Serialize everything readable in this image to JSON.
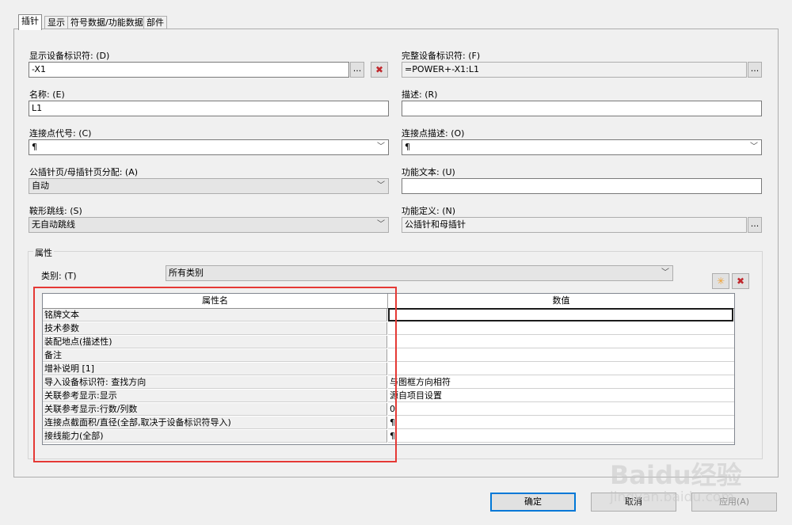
{
  "tabs": [
    "插针",
    "显示",
    "符号数据/功能数据",
    "部件"
  ],
  "fields": {
    "device_tag_label": "显示设备标识符: (D)",
    "device_tag_value": "-X1",
    "full_tag_label": "完整设备标识符: (F)",
    "full_tag_value": "=POWER+-X1:L1",
    "name_label": "名称: (E)",
    "name_value": "L1",
    "desc_label": "描述: (R)",
    "desc_value": "",
    "conn_code_label": "连接点代号: (C)",
    "conn_code_value": "¶",
    "conn_desc_label": "连接点描述: (O)",
    "conn_desc_value": "¶",
    "page_assign_label": "公插针页/母插针页分配: (A)",
    "page_assign_value": "自动",
    "func_text_label": "功能文本: (U)",
    "func_text_value": "",
    "jumper_label": "鞍形跳线: (S)",
    "jumper_value": "无自动跳线",
    "func_def_label": "功能定义: (N)",
    "func_def_value": "公插针和母插针",
    "browse_label": "...",
    "delete_glyph": "✖"
  },
  "properties": {
    "group_title": "属性",
    "category_label": "类别: (T)",
    "category_value": "所有类别",
    "new_glyph": "✳",
    "delete_glyph": "✖",
    "col_name": "属性名",
    "col_value": "数值",
    "rows": [
      {
        "name": "铭牌文本",
        "value": ""
      },
      {
        "name": "技术参数",
        "value": ""
      },
      {
        "name": "装配地点(描述性)",
        "value": ""
      },
      {
        "name": "备注",
        "value": ""
      },
      {
        "name": "增补说明 [1]",
        "value": ""
      },
      {
        "name": "导入设备标识符: 查找方向",
        "value": "与图框方向相符"
      },
      {
        "name": "关联参考显示:显示",
        "value": "源自项目设置"
      },
      {
        "name": "关联参考显示:行数/列数",
        "value": "0"
      },
      {
        "name": "连接点截面积/直径(全部,取决于设备标识符导入)",
        "value": "¶"
      },
      {
        "name": "接线能力(全部)",
        "value": "¶"
      }
    ]
  },
  "buttons": {
    "ok": "确定",
    "cancel": "取消",
    "apply": "应用(A)"
  },
  "watermark": {
    "brand": "Baidu经验",
    "url": "jingyan.baidu.com"
  },
  "colors": {
    "highlight_box": "#e53935",
    "default_button_border": "#0078d7",
    "delete_red": "#c0282d",
    "new_orange": "#f0a030"
  }
}
